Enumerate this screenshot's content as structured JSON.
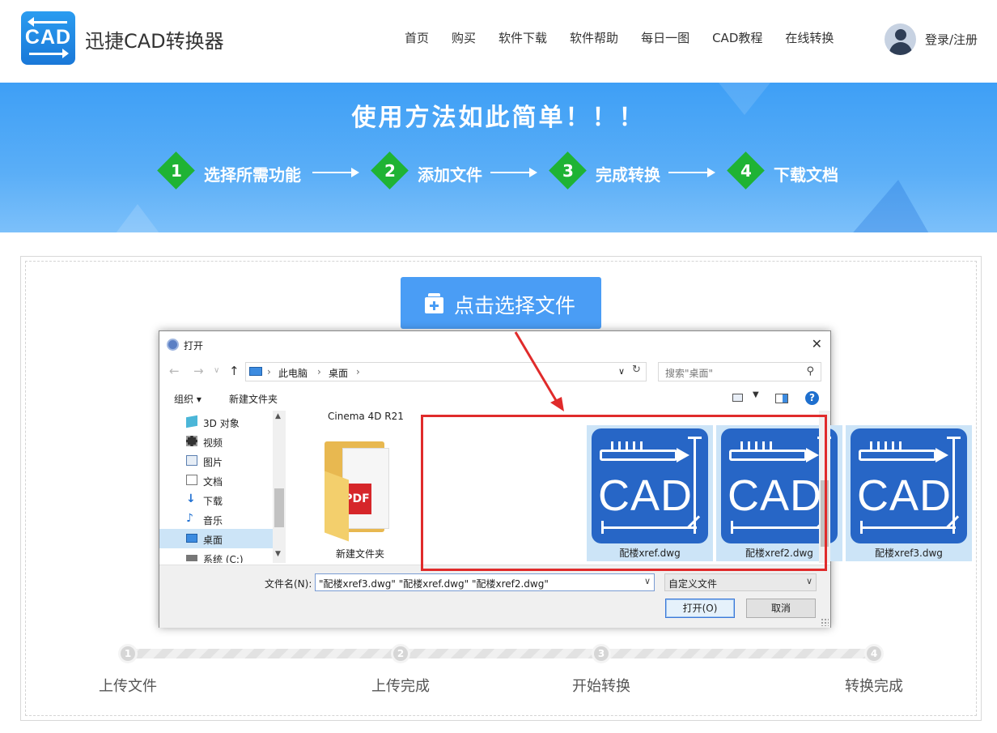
{
  "header": {
    "logo_text": "CAD",
    "brand": "迅捷CAD转换器",
    "nav": [
      "首页",
      "购买",
      "软件下载",
      "软件帮助",
      "每日一图",
      "CAD教程",
      "在线转换"
    ],
    "login": "登录/注册"
  },
  "banner": {
    "title": "使用方法如此简单！！！",
    "steps": [
      {
        "num": "1",
        "label": "选择所需功能"
      },
      {
        "num": "2",
        "label": "添加文件"
      },
      {
        "num": "3",
        "label": "完成转换"
      },
      {
        "num": "4",
        "label": "下载文档"
      }
    ]
  },
  "upload": {
    "select_button": "点击选择文件"
  },
  "dialog": {
    "title": "打开",
    "breadcrumb": [
      "此电脑",
      "桌面"
    ],
    "search_placeholder": "搜索\"桌面\"",
    "organize": "组织",
    "new_folder": "新建文件夹",
    "help": "?",
    "tree": [
      {
        "label": "3D 对象",
        "icon": "cube-icon"
      },
      {
        "label": "视频",
        "icon": "film-icon"
      },
      {
        "label": "图片",
        "icon": "image-icon"
      },
      {
        "label": "文档",
        "icon": "document-icon"
      },
      {
        "label": "下载",
        "icon": "download-icon"
      },
      {
        "label": "音乐",
        "icon": "music-icon"
      },
      {
        "label": "桌面",
        "icon": "desktop-icon"
      },
      {
        "label": "系统 (C:)",
        "icon": "drive-icon"
      }
    ],
    "files": {
      "cinema_label": "Cinema 4D R21",
      "folder_label": "新建文件夹",
      "pdf_text": "PDF",
      "cad_icon_text": "CAD",
      "cad_files": [
        "配楼xref.dwg",
        "配楼xref2.dwg",
        "配楼xref3.dwg"
      ]
    },
    "filename_label": "文件名(N):",
    "filename_value": "\"配楼xref3.dwg\" \"配楼xref.dwg\" \"配楼xref2.dwg\"",
    "filetype": "自定义文件",
    "open_button": "打开(O)",
    "cancel_button": "取消"
  },
  "progress": {
    "steps": [
      {
        "num": "1",
        "label": "上传文件"
      },
      {
        "num": "2",
        "label": "上传完成"
      },
      {
        "num": "3",
        "label": "开始转换"
      },
      {
        "num": "4",
        "label": "转换完成"
      }
    ]
  },
  "colors": {
    "accent": "#4a9df5",
    "step_green": "#1fb334",
    "cad_blue": "#2766c6",
    "highlight_red": "#e02b2b"
  }
}
